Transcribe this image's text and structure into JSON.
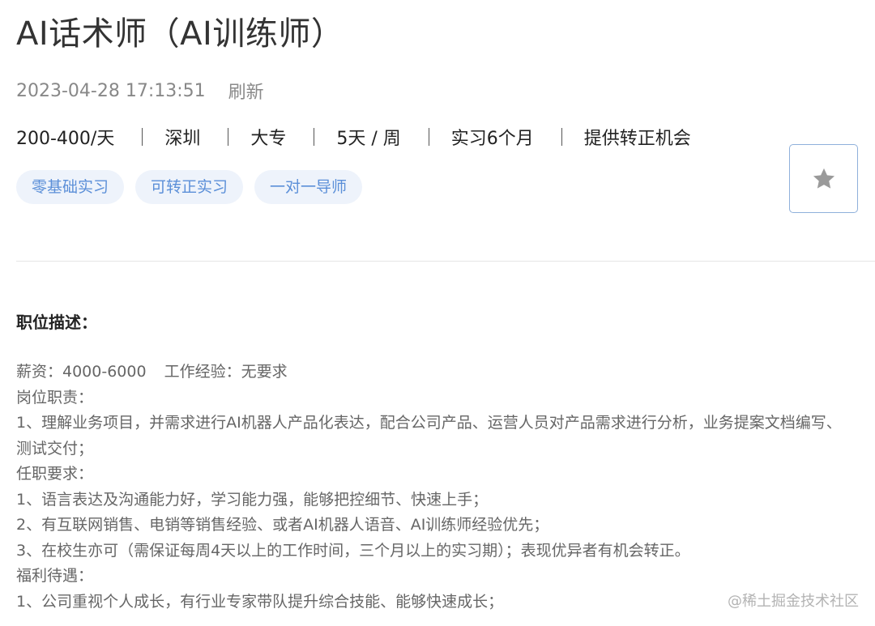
{
  "job": {
    "title": "AI话术师（AI训练师）",
    "updated_at": "2023-04-28 17:13:51",
    "refresh_label": "刷新",
    "salary": "200-400/天",
    "city": "深圳",
    "education": "大专",
    "days_per_week": "5天 / 周",
    "duration": "实习6个月",
    "conversion": "提供转正机会",
    "tags": [
      "零基础实习",
      "可转正实习",
      "一对一导师"
    ],
    "favorite_icon": "star-icon"
  },
  "description": {
    "section_title": "职位描述：",
    "salary_line": "薪资：4000-6000",
    "experience_line": "工作经验：无要求",
    "duties_title": "岗位职责：",
    "duty_1": "1、理解业务项目，并需求进行AI机器人产品化表达，配合公司产品、运营人员对产品需求进行分析，业务提案文档编写、测试交付；",
    "requirements_title": "任职要求：",
    "req_1": "1、语言表达及沟通能力好，学习能力强，能够把控细节、快速上手；",
    "req_2": "2、有互联网销售、电销等销售经验、或者AI机器人语音、AI训练师经验优先；",
    "req_3": "3、在校生亦可（需保证每周4天以上的工作时间，三个月以上的实习期）；表现优异者有机会转正。",
    "benefits_title": "福利待遇：",
    "benefit_1": "1、公司重视个人成长，有行业专家带队提升综合技能、能够快速成长；"
  },
  "watermark": "@稀土掘金技术社区",
  "colors": {
    "tag_bg": "#eef3fb",
    "tag_text": "#5b8fd8",
    "fav_border": "#8fb0db",
    "star": "#9a9a9a"
  }
}
